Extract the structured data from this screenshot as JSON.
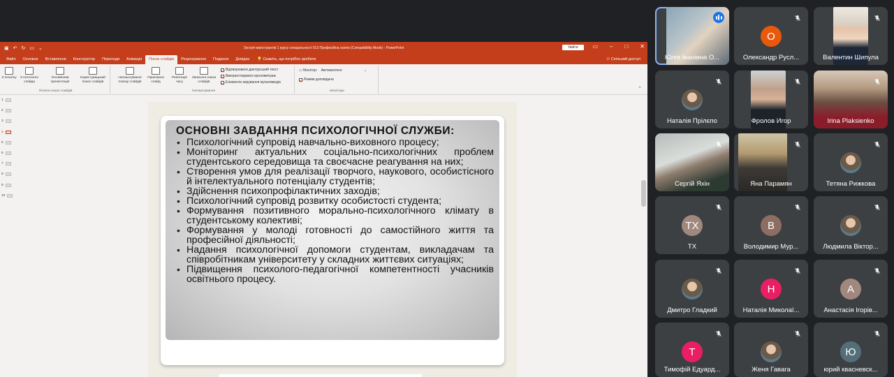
{
  "ppt": {
    "doc_title": "Зустріч магістрантів 1 курсу спеціальності 013 Професійна освіта (Compatibility Mode) - PowerPoint",
    "login_label": "Увійти",
    "tabs": [
      "Файл",
      "Основне",
      "Вставлення",
      "Конструктор",
      "Переходи",
      "Анімація",
      "Показ слайдів",
      "Рецензування",
      "Подання",
      "Довідка"
    ],
    "active_tab": "Показ слайдів",
    "search_text": "Скажіть, що потрібно зробити",
    "share_label": "Спільний доступ",
    "ribbon": {
      "btn_from_start": "З початку",
      "btn_from_current": "З поточного слайда",
      "btn_online": "Онлайнова презентація",
      "btn_custom": "Користувацький показ слайдів",
      "group_start": "Почати показ слайдів",
      "btn_setup": "Налаштування показу слайдів",
      "btn_hide": "Приховати слайд",
      "btn_rehearse": "Репетиція часу",
      "btn_record": "Записати показ слайдів",
      "check_narrations": "Відтворювати дикторський текст",
      "check_timings": "Використовувати хронометраж",
      "check_controls": "Елементи керування мультимедіа",
      "group_setup": "Налаштування",
      "monitor_label": "Монітор:",
      "monitor_value": "Автоматично",
      "presenter_view": "Режим доповідача",
      "group_monitors": "Монітори"
    },
    "slide_numbers": [
      "1",
      "2",
      "3",
      "4",
      "5",
      "6",
      "7",
      "8",
      "9",
      "10"
    ],
    "active_slide": "4"
  },
  "slide": {
    "title": "ОСНОВНІ ЗАВДАННЯ ПСИХОЛОГІЧНОЇ СЛУЖБИ:",
    "items": [
      "Психологічний супровід навчально-виховного процесу;",
      "Моніторинг актуальних соціально-психологічних проблем студентського середовища та своєчасне реагування на них;",
      "Створення умов для реалізації творчого, наукового, особистісного й інтелектуального потенціалу студентів;",
      "Здійснення психопрофілактичних заходів;",
      "Психологічний супровід розвитку особистості студента;",
      "Формування позитивного морально-психологічного клімату в студентському колективі;",
      "Формування у молоді готовності до самостійного життя та професійної діяльності;",
      "Надання психологічної допомоги студентам, викладачам та співробітникам університету у складних життєвих ситуаціях;",
      "Підвищення психолого-педагогічної компетентності учасників освітнього процесу."
    ]
  },
  "participants": [
    {
      "name": "Юлія Іванівна О...",
      "kind": "video",
      "speaking": true
    },
    {
      "name": "Олександр Русл...",
      "kind": "letter",
      "letter": "О",
      "color": "#e8590c"
    },
    {
      "name": "Валентин Шипула",
      "kind": "video"
    },
    {
      "name": "Наталія Прілєпо",
      "kind": "photo"
    },
    {
      "name": "Фролов Игор",
      "kind": "video"
    },
    {
      "name": "Irina Plaksienko",
      "kind": "video"
    },
    {
      "name": "Сергій Яхін",
      "kind": "video"
    },
    {
      "name": "Яна Парамян",
      "kind": "video"
    },
    {
      "name": "Тетяна Рижкова",
      "kind": "photo"
    },
    {
      "name": "ТХ",
      "kind": "letter",
      "letter": "ТХ",
      "color": "#a1887f"
    },
    {
      "name": "Володимир Мур...",
      "kind": "letter",
      "letter": "В",
      "color": "#8d6e63"
    },
    {
      "name": "Людмила Віктор...",
      "kind": "photo"
    },
    {
      "name": "Дмитро Гладкий",
      "kind": "photo"
    },
    {
      "name": "Наталія Миколаї...",
      "kind": "letter",
      "letter": "Н",
      "color": "#e91e63"
    },
    {
      "name": "Анастасія Ігорів...",
      "kind": "letter",
      "letter": "А",
      "color": "#a1887f"
    },
    {
      "name": "Тимофій Едуард...",
      "kind": "letter",
      "letter": "Т",
      "color": "#e91e63"
    },
    {
      "name": "Женя Гавага",
      "kind": "photo"
    },
    {
      "name": "юрий квасневск...",
      "kind": "letter",
      "letter": "Ю",
      "color": "#546e7a"
    }
  ],
  "colors": {
    "ppt_accent": "#c43e1c",
    "meet_bg": "#202124",
    "tile_bg": "#3c4043",
    "speaker_outline": "#8ab4f8"
  }
}
